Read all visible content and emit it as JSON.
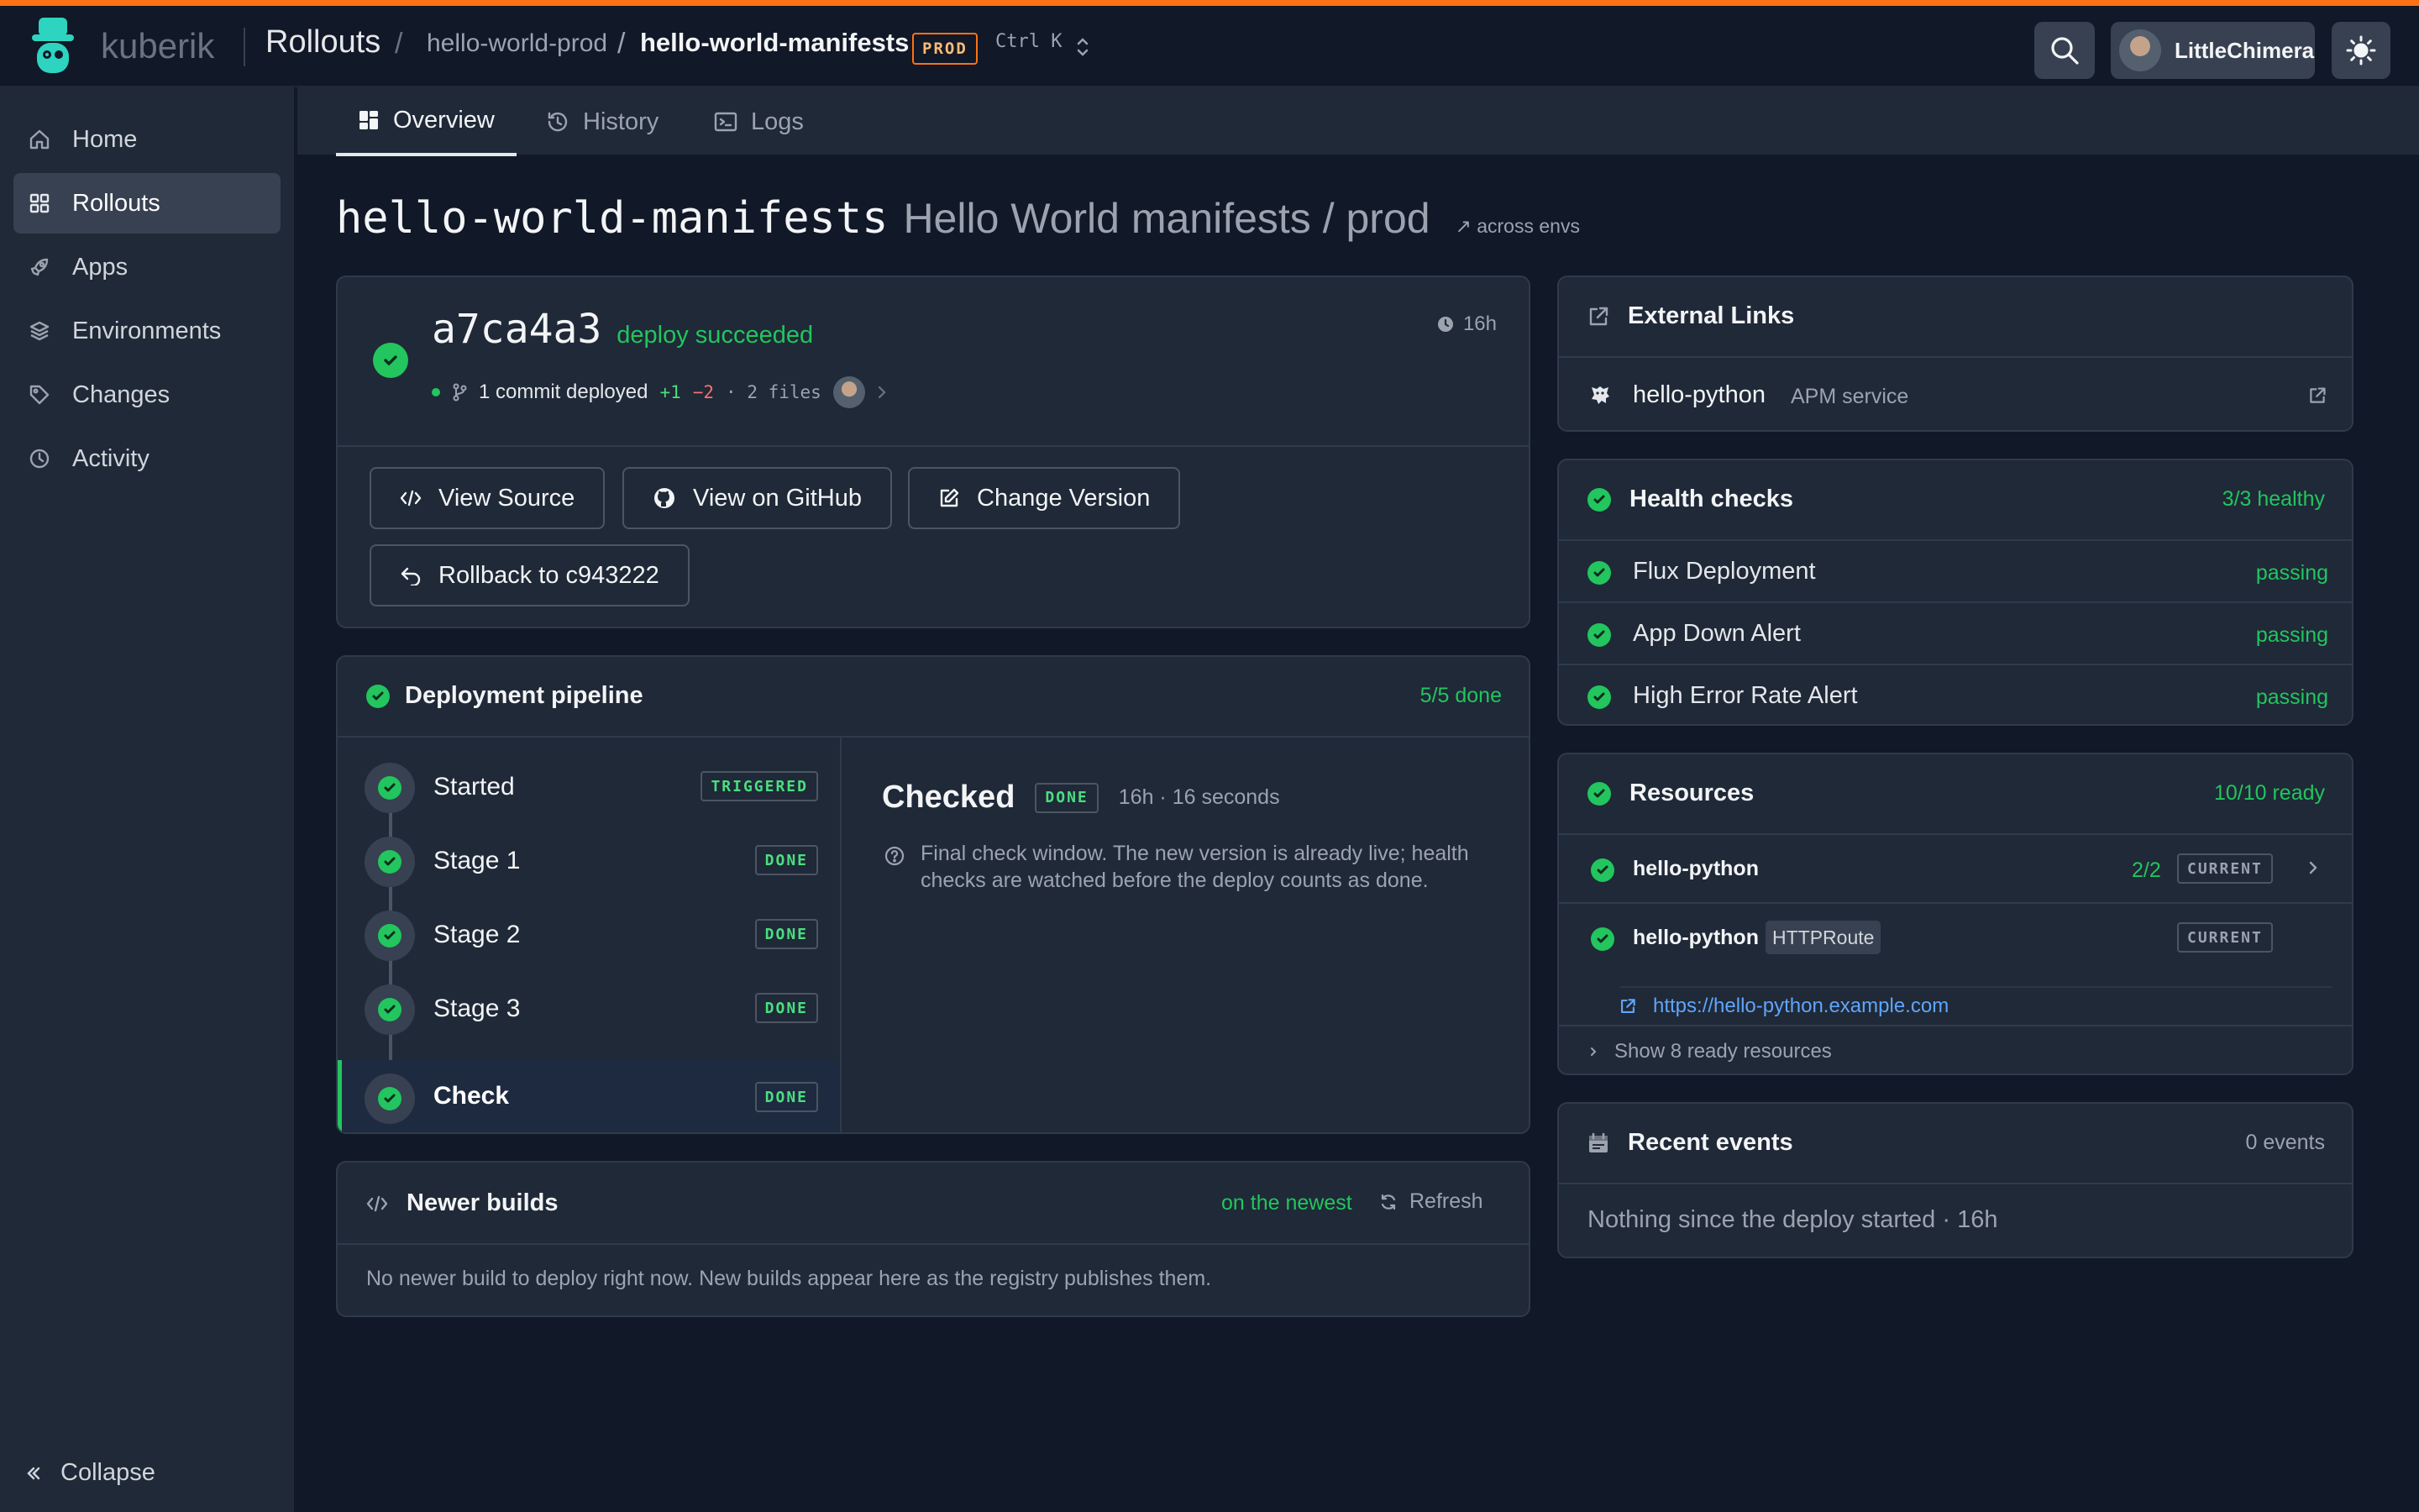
{
  "topbar": {
    "brand": "kuberik",
    "app_title": "Rollouts",
    "breadcrumb": [
      "hello-world-prod",
      "hello-world-manifests"
    ],
    "env_badge": "PROD",
    "shortcut": "Ctrl K",
    "user": "LittleChimera",
    "accent": "#f97316"
  },
  "sidebar": {
    "items": [
      {
        "label": "Home",
        "icon": "home-icon"
      },
      {
        "label": "Rollouts",
        "icon": "grid-icon",
        "active": true
      },
      {
        "label": "Apps",
        "icon": "rocket-icon"
      },
      {
        "label": "Environments",
        "icon": "layers-icon"
      },
      {
        "label": "Changes",
        "icon": "tag-icon"
      },
      {
        "label": "Activity",
        "icon": "clock-icon"
      }
    ],
    "collapse_label": "Collapse"
  },
  "tabs": [
    {
      "label": "Overview",
      "icon": "dashboard-icon",
      "active": true
    },
    {
      "label": "History",
      "icon": "history-icon"
    },
    {
      "label": "Logs",
      "icon": "terminal-icon"
    }
  ],
  "heading": {
    "slug": "hello-world-manifests",
    "subtitle": "Hello World manifests / prod",
    "across": "↗ across envs"
  },
  "deploy": {
    "commit": "a7ca4a3",
    "status": "deploy succeeded",
    "age": "16h",
    "summary": "1 commit deployed",
    "additions": "+1",
    "deletions": "−2",
    "files": "· 2 files",
    "buttons": {
      "view_source": "View Source",
      "view_github": "View on GitHub",
      "change_version": "Change Version",
      "rollback": "Rollback to c943222"
    }
  },
  "pipeline": {
    "title": "Deployment pipeline",
    "progress": "5/5 done",
    "stages": [
      {
        "name": "Started",
        "badge": "TRIGGERED"
      },
      {
        "name": "Stage 1",
        "badge": "DONE"
      },
      {
        "name": "Stage 2",
        "badge": "DONE"
      },
      {
        "name": "Stage 3",
        "badge": "DONE"
      },
      {
        "name": "Check",
        "badge": "DONE",
        "selected": true
      }
    ],
    "detail": {
      "title": "Checked",
      "badge": "DONE",
      "meta": "16h · 16 seconds",
      "description_1": "Final check window. The new version is already live; health",
      "description_2": "checks are watched before the deploy counts as done."
    }
  },
  "newer_builds": {
    "title": "Newer builds",
    "status": "on the newest",
    "refresh": "Refresh",
    "message": "No newer build to deploy right now. New builds appear here as the registry publishes them."
  },
  "external_links": {
    "title": "External Links",
    "items": [
      {
        "name": "hello-python",
        "type": "APM service"
      }
    ]
  },
  "health_checks": {
    "title": "Health checks",
    "summary": "3/3 healthy",
    "items": [
      {
        "name": "Flux Deployment",
        "status": "passing"
      },
      {
        "name": "App Down Alert",
        "status": "passing"
      },
      {
        "name": "High Error Rate Alert",
        "status": "passing"
      }
    ]
  },
  "resources": {
    "title": "Resources",
    "summary": "10/10 ready",
    "items": [
      {
        "name": "hello-python",
        "ratio": "2/2",
        "badge": "CURRENT"
      },
      {
        "name": "hello-python",
        "kind": "HTTPRoute",
        "badge": "CURRENT",
        "link": "https://hello-python.example.com"
      }
    ],
    "show_more": "Show 8 ready resources"
  },
  "recent_events": {
    "title": "Recent events",
    "count": "0 events",
    "message": "Nothing since the deploy started · 16h"
  }
}
